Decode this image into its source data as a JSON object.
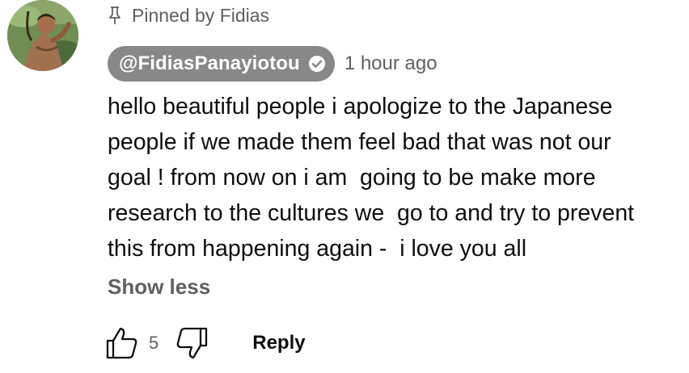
{
  "pinned": {
    "text": "Pinned by Fidias",
    "icon": "pin-icon"
  },
  "author": {
    "handle": "@FidiasPanayiotou",
    "verified_icon": "verified-checkmark-icon",
    "chip_color": "#888888",
    "avatar_icon": "user-avatar"
  },
  "timestamp": "1 hour ago",
  "comment": {
    "text": "hello beautiful people i apologize to the Japanese\npeople if we made them feel bad that was not our\ngoal ! from now on i am  going to be make more\nresearch to the cultures we  go to and try to prevent\nthis from happening again -  i love you all"
  },
  "show_less_label": "Show less",
  "actions": {
    "like_icon": "thumbs-up-icon",
    "like_count": "5",
    "dislike_icon": "thumbs-down-icon",
    "reply_label": "Reply"
  }
}
